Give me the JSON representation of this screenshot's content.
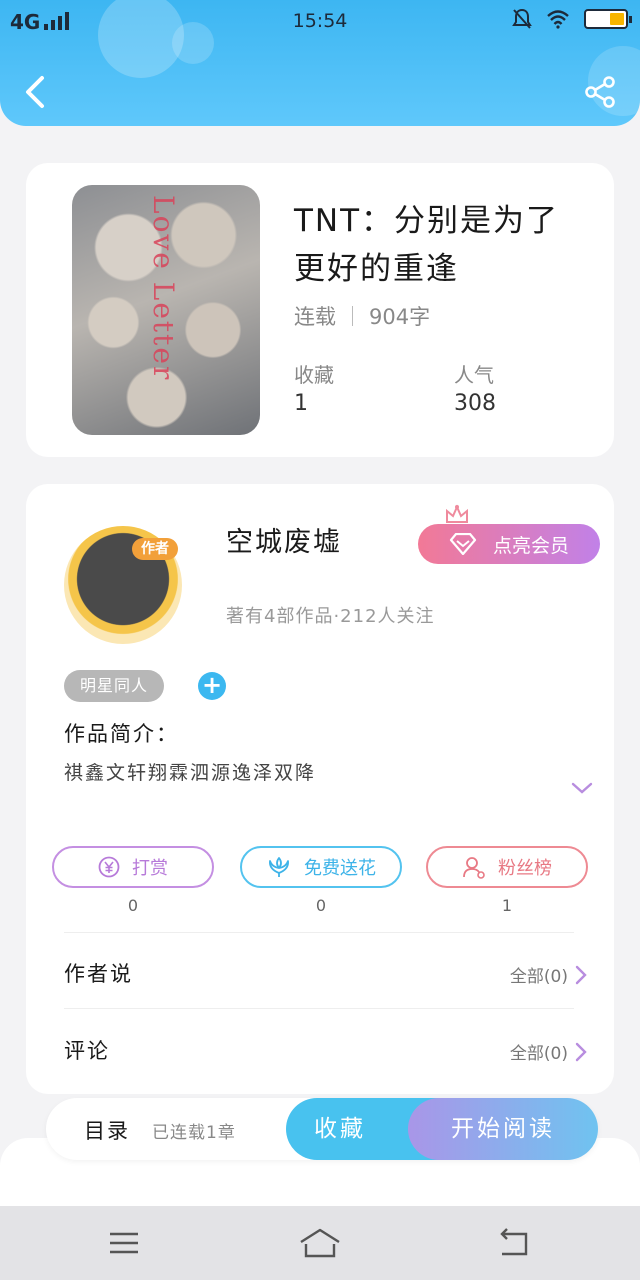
{
  "status_bar": {
    "network": "4G",
    "time": "15:54"
  },
  "colors": {
    "header": "#4cbff6",
    "accent": "#3cb8f0",
    "vip_gradient_start": "#f27996",
    "vip_gradient_end": "#c181e8",
    "reward": "#b77ad9",
    "flower": "#3db3e8",
    "fans": "#e87984"
  },
  "header": {
    "back_icon": "chevron-left-icon",
    "share_icon": "share-icon"
  },
  "book": {
    "cover_text": "Love Letter",
    "title": "TNT：分别是为了更好的重逢",
    "status": "连载",
    "word_count": "904字",
    "stats": {
      "favorites_label": "收藏",
      "favorites_value": "1",
      "popularity_label": "人气",
      "popularity_value": "308"
    }
  },
  "author": {
    "tag": "作者",
    "name": "空城废墟",
    "info": "著有4部作品·212人关注",
    "vip_button": "点亮会员",
    "vip_icon": "diamond-icon",
    "crown_icon": "crown-icon"
  },
  "tags": {
    "chip": "明星同人",
    "add_icon": "plus-icon"
  },
  "intro": {
    "label": "作品简介：",
    "text": "祺鑫文轩翔霖泗源逸泽双降"
  },
  "actions": [
    {
      "label": "打赏",
      "icon": "yuan-coin-icon",
      "count": "0"
    },
    {
      "label": "免费送花",
      "icon": "flower-icon",
      "count": "0"
    },
    {
      "label": "粉丝榜",
      "icon": "user-icon",
      "count": "1"
    }
  ],
  "rows": {
    "author_says_label": "作者说",
    "author_says_more": "全部(0)",
    "comments_label": "评论",
    "comments_more": "全部(0)"
  },
  "read_bar": {
    "toc_label": "目录",
    "toc_status": "已连载1章",
    "favorite_button": "收藏",
    "start_button": "开始阅读"
  },
  "navbar": {
    "menu_icon": "menu-icon",
    "home_icon": "home-icon",
    "back_icon": "back-icon"
  }
}
